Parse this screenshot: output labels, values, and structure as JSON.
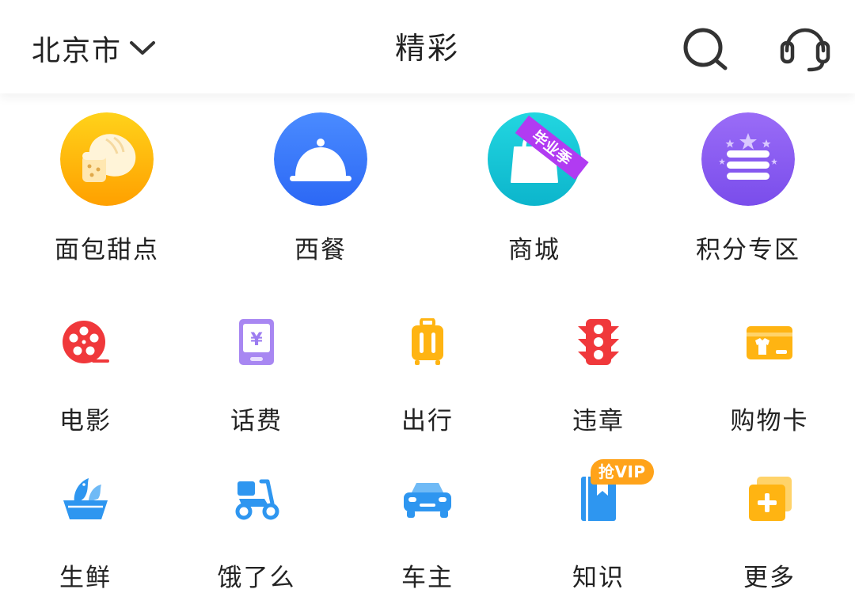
{
  "header": {
    "city": "北京市",
    "title": "精彩"
  },
  "colors": {
    "bread": "#FFB300",
    "western": "#3A7BFF",
    "mall": "#12C9D8",
    "points": "#8A5BF5",
    "ribbon": "#B13BF2",
    "movie_red": "#F0383B",
    "phone_purple": "#9C7CF0",
    "travel_yellow": "#FFB412",
    "fresh_blue": "#2E96F0",
    "vip_orange": "#FFA31A"
  },
  "big_items": [
    {
      "label": "面包甜点",
      "icon": "bread-icon"
    },
    {
      "label": "西餐",
      "icon": "cloche-icon"
    },
    {
      "label": "商城",
      "icon": "shopping-bag-icon",
      "ribbon": "毕业季"
    },
    {
      "label": "积分专区",
      "icon": "points-list-icon"
    }
  ],
  "small_items_row1": [
    {
      "label": "电影",
      "icon": "film-reel-icon"
    },
    {
      "label": "话费",
      "icon": "phone-yuan-icon",
      "glyph": "¥"
    },
    {
      "label": "出行",
      "icon": "luggage-icon"
    },
    {
      "label": "违章",
      "icon": "traffic-light-icon"
    },
    {
      "label": "购物卡",
      "icon": "shopping-card-icon"
    }
  ],
  "small_items_row2": [
    {
      "label": "生鲜",
      "icon": "fish-basket-icon"
    },
    {
      "label": "饿了么",
      "icon": "scooter-icon"
    },
    {
      "label": "车主",
      "icon": "car-icon"
    },
    {
      "label": "知识",
      "icon": "book-icon",
      "badge": "抢VIP"
    },
    {
      "label": "更多",
      "icon": "more-plus-icon"
    }
  ]
}
